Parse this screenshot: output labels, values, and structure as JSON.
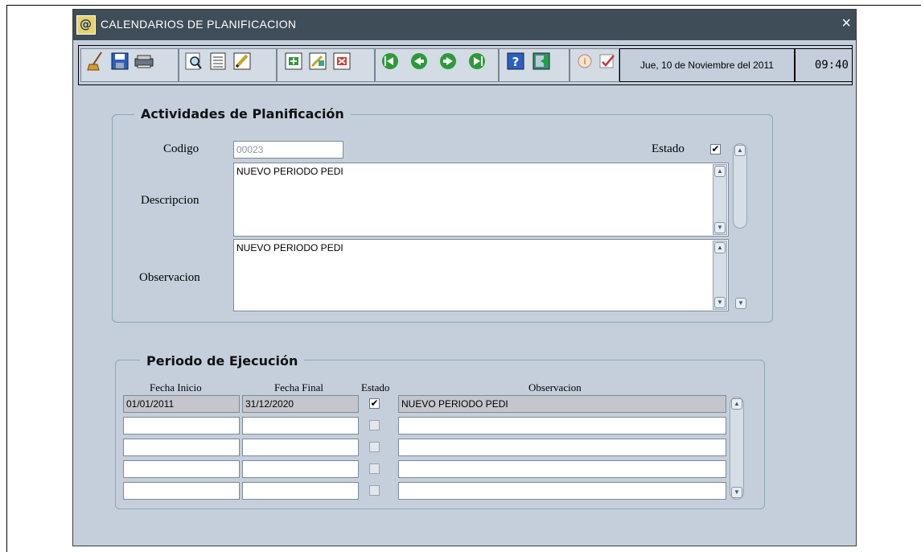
{
  "window": {
    "title": "CALENDARIOS DE PLANIFICACION",
    "close_glyph": "×"
  },
  "toolbar": {
    "date": "Jue, 10 de Noviembre del 2011",
    "time": "09:40",
    "icons": [
      "broom-icon",
      "save-icon",
      "print-icon",
      "query-icon",
      "list-icon",
      "edit-icon",
      "insert-record-icon",
      "duplicate-record-icon",
      "delete-record-icon",
      "first-record-icon",
      "previous-record-icon",
      "next-record-icon",
      "last-record-icon",
      "help-icon",
      "exit-icon",
      "info-icon",
      "check-icon"
    ]
  },
  "actividades": {
    "title": "Actividades de Planificación",
    "codigo_label": "Codigo",
    "codigo_value": "00023",
    "estado_label": "Estado",
    "estado_checked": "✔",
    "descripcion_label": "Descripcion",
    "descripcion_value": "NUEVO PERIODO PEDI",
    "observacion_label": "Observacion",
    "observacion_value": "NUEVO PERIODO PEDI"
  },
  "periodo": {
    "title": "Periodo de Ejecución",
    "headers": {
      "fecha_inicio": "Fecha Inicio",
      "fecha_final": "Fecha Final",
      "estado": "Estado",
      "observacion": "Observacion"
    },
    "rows": [
      {
        "fecha_inicio": "01/01/2011",
        "fecha_final": "31/12/2020",
        "estado": "✔",
        "observacion": "NUEVO PERIODO PEDI"
      },
      {
        "fecha_inicio": "",
        "fecha_final": "",
        "estado": "",
        "observacion": ""
      },
      {
        "fecha_inicio": "",
        "fecha_final": "",
        "estado": "",
        "observacion": ""
      },
      {
        "fecha_inicio": "",
        "fecha_final": "",
        "estado": "",
        "observacion": ""
      },
      {
        "fecha_inicio": "",
        "fecha_final": "",
        "estado": "",
        "observacion": ""
      }
    ]
  },
  "colors": {
    "titlebar": "#3f4d58",
    "window_bg": "#c5cfdc",
    "frame_border": "#8aa7b3"
  }
}
